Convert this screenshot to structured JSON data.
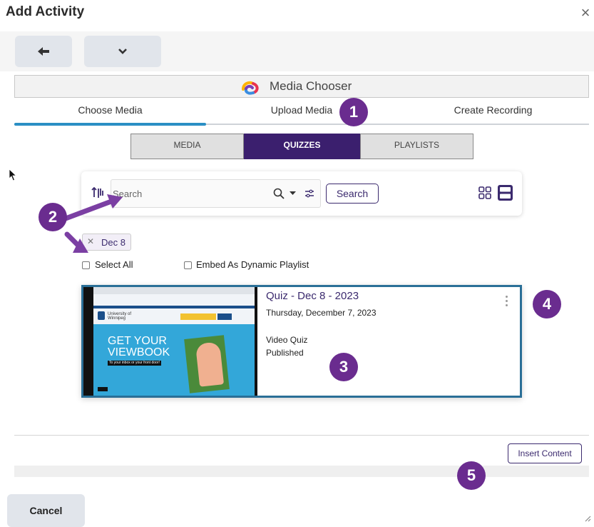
{
  "dialog": {
    "title": "Add Activity",
    "close_glyph": "×"
  },
  "toolbar": {
    "back_icon": "arrow-left-icon",
    "dropdown_icon": "chevron-down-icon"
  },
  "media_chooser": {
    "title": "Media Chooser",
    "logo_colors": [
      "#ffb300",
      "#e8334f",
      "#3a8de0",
      "#7a3fb5"
    ],
    "tabs": [
      {
        "label": "Choose Media",
        "active": true
      },
      {
        "label": "Upload Media",
        "active": false
      },
      {
        "label": "Create Recording",
        "active": false
      }
    ],
    "segments": [
      {
        "label": "MEDIA",
        "active": false
      },
      {
        "label": "QUIZZES",
        "active": true
      },
      {
        "label": "PLAYLISTS",
        "active": false
      }
    ]
  },
  "search": {
    "placeholder": "Search",
    "button_label": "Search",
    "sort_icon": "sort-icon",
    "magnifier_icon": "search-icon",
    "filter_icon": "filter-sliders-icon",
    "view_icons": [
      "grid-view-icon",
      "list-view-icon"
    ]
  },
  "filter_chip": {
    "label": "Dec 8",
    "remove_glyph": "✕"
  },
  "options": {
    "select_all": "Select All",
    "embed_playlist": "Embed As Dynamic Playlist"
  },
  "results": [
    {
      "title": "Quiz - Dec 8 - 2023",
      "date": "Thursday, December 7, 2023",
      "type": "Video Quiz",
      "status": "Published",
      "thumbnail": {
        "logo_text": "University of Winnipeg",
        "headline_1": "GET YOUR",
        "headline_2": "VIEWBOOK",
        "tagline": "To your inbox or your front door!"
      }
    }
  ],
  "footer": {
    "insert_label": "Insert Content",
    "cancel_label": "Cancel"
  },
  "annotations": [
    "1",
    "2",
    "3",
    "4",
    "5"
  ],
  "colors": {
    "accent_purple": "#3b1f6e",
    "tab_blue": "#2b8fc4",
    "badge_purple": "#6a2c8f",
    "card_border": "#2a6f97"
  }
}
